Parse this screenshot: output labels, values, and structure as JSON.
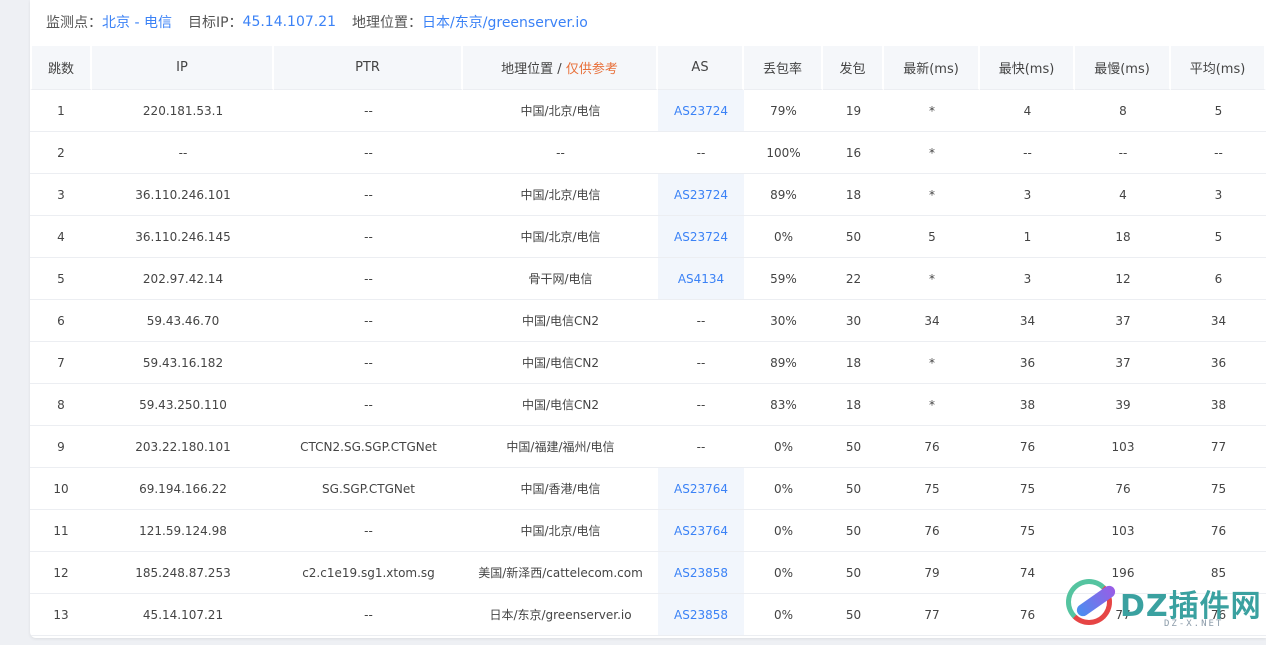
{
  "info": {
    "probe_label": "监测点：",
    "probe_value": "北京 - 电信",
    "target_label": "目标IP：",
    "target_value": "45.14.107.21",
    "geo_label": "地理位置：",
    "geo_value": "日本/东京/greenserver.io"
  },
  "columns": {
    "hop": "跳数",
    "ip": "IP",
    "ptr": "PTR",
    "geo": "地理位置 / ",
    "geo_note": "仅供参考",
    "as": "AS",
    "loss": "丢包率",
    "sent": "发包",
    "last": "最新(ms)",
    "best": "最快(ms)",
    "worst": "最慢(ms)",
    "avg": "平均(ms)"
  },
  "rows": [
    {
      "hop": "1",
      "ip": "220.181.53.1",
      "ptr": "--",
      "geo": "中国/北京/电信",
      "as": "AS23724",
      "loss": "79%",
      "sent": "19",
      "last": "*",
      "best": "4",
      "worst": "8",
      "avg": "5"
    },
    {
      "hop": "2",
      "ip": "--",
      "ptr": "--",
      "geo": "--",
      "as": "--",
      "loss": "100%",
      "sent": "16",
      "last": "*",
      "best": "--",
      "worst": "--",
      "avg": "--"
    },
    {
      "hop": "3",
      "ip": "36.110.246.101",
      "ptr": "--",
      "geo": "中国/北京/电信",
      "as": "AS23724",
      "loss": "89%",
      "sent": "18",
      "last": "*",
      "best": "3",
      "worst": "4",
      "avg": "3"
    },
    {
      "hop": "4",
      "ip": "36.110.246.145",
      "ptr": "--",
      "geo": "中国/北京/电信",
      "as": "AS23724",
      "loss": "0%",
      "sent": "50",
      "last": "5",
      "best": "1",
      "worst": "18",
      "avg": "5"
    },
    {
      "hop": "5",
      "ip": "202.97.42.14",
      "ptr": "--",
      "geo": "骨干网/电信",
      "as": "AS4134",
      "loss": "59%",
      "sent": "22",
      "last": "*",
      "best": "3",
      "worst": "12",
      "avg": "6"
    },
    {
      "hop": "6",
      "ip": "59.43.46.70",
      "ptr": "--",
      "geo": "中国/电信CN2",
      "as": "--",
      "loss": "30%",
      "sent": "30",
      "last": "34",
      "best": "34",
      "worst": "37",
      "avg": "34"
    },
    {
      "hop": "7",
      "ip": "59.43.16.182",
      "ptr": "--",
      "geo": "中国/电信CN2",
      "as": "--",
      "loss": "89%",
      "sent": "18",
      "last": "*",
      "best": "36",
      "worst": "37",
      "avg": "36"
    },
    {
      "hop": "8",
      "ip": "59.43.250.110",
      "ptr": "--",
      "geo": "中国/电信CN2",
      "as": "--",
      "loss": "83%",
      "sent": "18",
      "last": "*",
      "best": "38",
      "worst": "39",
      "avg": "38"
    },
    {
      "hop": "9",
      "ip": "203.22.180.101",
      "ptr": "CTCN2.SG.SGP.CTGNet",
      "geo": "中国/福建/福州/电信",
      "as": "--",
      "loss": "0%",
      "sent": "50",
      "last": "76",
      "best": "76",
      "worst": "103",
      "avg": "77"
    },
    {
      "hop": "10",
      "ip": "69.194.166.22",
      "ptr": "SG.SGP.CTGNet",
      "geo": "中国/香港/电信",
      "as": "AS23764",
      "loss": "0%",
      "sent": "50",
      "last": "75",
      "best": "75",
      "worst": "76",
      "avg": "75"
    },
    {
      "hop": "11",
      "ip": "121.59.124.98",
      "ptr": "--",
      "geo": "中国/北京/电信",
      "as": "AS23764",
      "loss": "0%",
      "sent": "50",
      "last": "76",
      "best": "75",
      "worst": "103",
      "avg": "76"
    },
    {
      "hop": "12",
      "ip": "185.248.87.253",
      "ptr": "c2.c1e19.sg1.xtom.sg",
      "geo": "美国/新泽西/cattelecom.com",
      "as": "AS23858",
      "loss": "0%",
      "sent": "50",
      "last": "79",
      "best": "74",
      "worst": "196",
      "avg": "85"
    },
    {
      "hop": "13",
      "ip": "45.14.107.21",
      "ptr": "--",
      "geo": "日本/东京/greenserver.io",
      "as": "AS23858",
      "loss": "0%",
      "sent": "50",
      "last": "77",
      "best": "76",
      "worst": "77",
      "avg": "76"
    }
  ],
  "watermark": {
    "text": "DZ插件网",
    "sub": "DZ-X.NET",
    "icon": "dz-logo-icon"
  },
  "colors": {
    "link": "#3b82f6",
    "warning": "#e8703a",
    "header_bg": "#f5f7fa",
    "as_cell_bg": "#f2f6fc"
  }
}
